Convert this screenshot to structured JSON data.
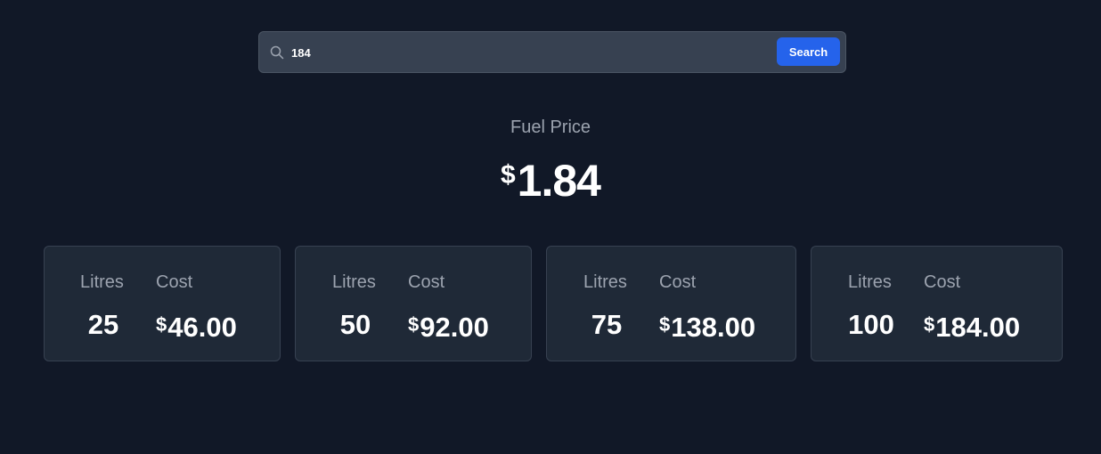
{
  "search": {
    "value": "184",
    "button_label": "Search",
    "button_color": "#2563eb"
  },
  "price": {
    "label": "Fuel Price",
    "currency": "$",
    "amount": "1.84"
  },
  "cards": [
    {
      "litres_label": "Litres",
      "cost_label": "Cost",
      "litres": "25",
      "currency": "$",
      "cost": "46.00"
    },
    {
      "litres_label": "Litres",
      "cost_label": "Cost",
      "litres": "50",
      "currency": "$",
      "cost": "92.00"
    },
    {
      "litres_label": "Litres",
      "cost_label": "Cost",
      "litres": "75",
      "currency": "$",
      "cost": "138.00"
    },
    {
      "litres_label": "Litres",
      "cost_label": "Cost",
      "litres": "100",
      "currency": "$",
      "cost": "184.00"
    }
  ]
}
